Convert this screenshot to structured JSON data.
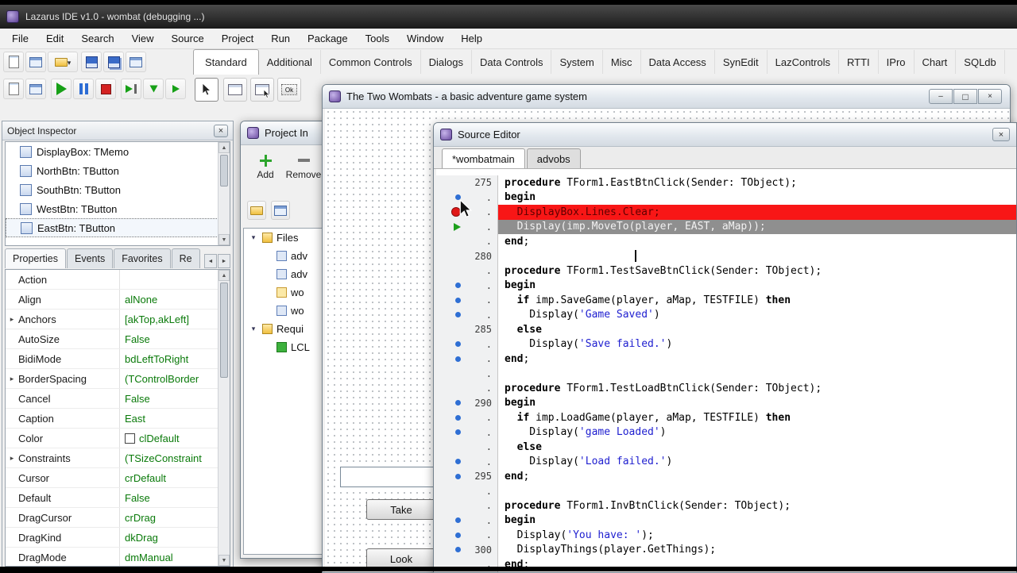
{
  "titlebar": {
    "title": "Lazarus IDE v1.0 - wombat (debugging ...)"
  },
  "menu": {
    "items": [
      "File",
      "Edit",
      "Search",
      "View",
      "Source",
      "Project",
      "Run",
      "Package",
      "Tools",
      "Window",
      "Help"
    ]
  },
  "palette": {
    "tabs": [
      "Standard",
      "Additional",
      "Common Controls",
      "Dialogs",
      "Data Controls",
      "System",
      "Misc",
      "Data Access",
      "SynEdit",
      "LazControls",
      "RTTI",
      "IPro",
      "Chart",
      "SQLdb"
    ],
    "active_tab": "Standard",
    "tbutton_icon_label": "Ok"
  },
  "object_inspector": {
    "title": "Object Inspector",
    "components": [
      "DisplayBox: TMemo",
      "NorthBtn: TButton",
      "SouthBtn: TButton",
      "WestBtn: TButton",
      "EastBtn: TButton"
    ],
    "selected_component": "EastBtn: TButton",
    "tabs": [
      "Properties",
      "Events",
      "Favorites",
      "Re"
    ],
    "active_tab": "Properties",
    "properties": [
      {
        "name": "Action",
        "value": "",
        "expand": false,
        "swatch": false
      },
      {
        "name": "Align",
        "value": "alNone",
        "expand": false,
        "swatch": false
      },
      {
        "name": "Anchors",
        "value": "[akTop,akLeft]",
        "expand": true,
        "swatch": false
      },
      {
        "name": "AutoSize",
        "value": "False",
        "expand": false,
        "swatch": false
      },
      {
        "name": "BidiMode",
        "value": "bdLeftToRight",
        "expand": false,
        "swatch": false
      },
      {
        "name": "BorderSpacing",
        "value": "(TControlBorder",
        "expand": true,
        "swatch": false
      },
      {
        "name": "Cancel",
        "value": "False",
        "expand": false,
        "swatch": false
      },
      {
        "name": "Caption",
        "value": "East",
        "expand": false,
        "swatch": false
      },
      {
        "name": "Color",
        "value": "clDefault",
        "expand": false,
        "swatch": true
      },
      {
        "name": "Constraints",
        "value": "(TSizeConstraint",
        "expand": true,
        "swatch": false
      },
      {
        "name": "Cursor",
        "value": "crDefault",
        "expand": false,
        "swatch": false
      },
      {
        "name": "Default",
        "value": "False",
        "expand": false,
        "swatch": false
      },
      {
        "name": "DragCursor",
        "value": "crDrag",
        "expand": false,
        "swatch": false
      },
      {
        "name": "DragKind",
        "value": "dkDrag",
        "expand": false,
        "swatch": false
      },
      {
        "name": "DragMode",
        "value": "dmManual",
        "expand": false,
        "swatch": false
      }
    ]
  },
  "project_inspector": {
    "title": "Project In",
    "add_label": "Add",
    "remove_label": "Remove",
    "tree": [
      {
        "label": "Files",
        "depth": 0,
        "icon": "folder2",
        "expanded": true
      },
      {
        "label": "adv",
        "depth": 1,
        "icon": "unit",
        "expanded": false
      },
      {
        "label": "adv",
        "depth": 1,
        "icon": "unit",
        "expanded": false
      },
      {
        "label": "wo",
        "depth": 1,
        "icon": "unit-form",
        "expanded": false
      },
      {
        "label": "wo",
        "depth": 1,
        "icon": "unit",
        "expanded": false
      },
      {
        "label": "Requi",
        "depth": 0,
        "icon": "folder2",
        "expanded": true
      },
      {
        "label": "LCL",
        "depth": 1,
        "icon": "package",
        "expanded": false
      }
    ]
  },
  "form_window": {
    "title": "The Two Wombats - a basic adventure game system",
    "buttons": [
      {
        "label": "Take"
      },
      {
        "label": "Look"
      }
    ]
  },
  "source_editor": {
    "title": "Source Editor",
    "tabs": [
      {
        "label": "*wombatmain",
        "active": true
      },
      {
        "label": "advobs",
        "active": false
      }
    ],
    "lines": [
      {
        "n": "275",
        "m": "",
        "bg": "",
        "c": [
          [
            "k",
            "procedure"
          ],
          [
            "t",
            " TForm1.EastBtnClick(Sender: TObject);"
          ]
        ]
      },
      {
        "n": ".",
        "m": "dot",
        "bg": "",
        "c": [
          [
            "k",
            "begin"
          ]
        ]
      },
      {
        "n": ".",
        "m": "bp",
        "bg": "red",
        "c": [
          [
            "t",
            "  DisplayBox.Lines.Clear;"
          ]
        ]
      },
      {
        "n": ".",
        "m": "exec",
        "bg": "gray",
        "c": [
          [
            "t",
            "  Display(imp.MoveTo(player, EAST, aMap));"
          ]
        ]
      },
      {
        "n": ".",
        "m": "",
        "bg": "",
        "c": [
          [
            "k",
            "end"
          ],
          [
            "t",
            ";"
          ]
        ]
      },
      {
        "n": "280",
        "m": "",
        "bg": "",
        "caret": true,
        "c": []
      },
      {
        "n": ".",
        "m": "",
        "bg": "",
        "c": [
          [
            "k",
            "procedure"
          ],
          [
            "t",
            " TForm1.TestSaveBtnClick(Sender: TObject);"
          ]
        ]
      },
      {
        "n": ".",
        "m": "dot",
        "bg": "",
        "c": [
          [
            "k",
            "begin"
          ]
        ]
      },
      {
        "n": ".",
        "m": "dot",
        "bg": "",
        "c": [
          [
            "t",
            "  "
          ],
          [
            "k",
            "if"
          ],
          [
            "t",
            " imp.SaveGame(player, aMap, TESTFILE) "
          ],
          [
            "k",
            "then"
          ]
        ]
      },
      {
        "n": ".",
        "m": "dot",
        "bg": "",
        "c": [
          [
            "t",
            "    Display("
          ],
          [
            "s",
            "'Game Saved'"
          ],
          [
            "t",
            ")"
          ]
        ]
      },
      {
        "n": "285",
        "m": "",
        "bg": "",
        "c": [
          [
            "t",
            "  "
          ],
          [
            "k",
            "else"
          ]
        ]
      },
      {
        "n": ".",
        "m": "dot",
        "bg": "",
        "c": [
          [
            "t",
            "    Display("
          ],
          [
            "s",
            "'Save failed.'"
          ],
          [
            "t",
            ")"
          ]
        ]
      },
      {
        "n": ".",
        "m": "dot",
        "bg": "",
        "c": [
          [
            "k",
            "end"
          ],
          [
            "t",
            ";"
          ]
        ]
      },
      {
        "n": ".",
        "m": "",
        "bg": "",
        "c": []
      },
      {
        "n": ".",
        "m": "",
        "bg": "",
        "c": [
          [
            "k",
            "procedure"
          ],
          [
            "t",
            " TForm1.TestLoadBtnClick(Sender: TObject);"
          ]
        ]
      },
      {
        "n": "290",
        "m": "dot",
        "bg": "",
        "c": [
          [
            "k",
            "begin"
          ]
        ]
      },
      {
        "n": ".",
        "m": "dot",
        "bg": "",
        "c": [
          [
            "t",
            "  "
          ],
          [
            "k",
            "if"
          ],
          [
            "t",
            " imp.LoadGame(player, aMap, TESTFILE) "
          ],
          [
            "k",
            "then"
          ]
        ]
      },
      {
        "n": ".",
        "m": "dot",
        "bg": "",
        "c": [
          [
            "t",
            "    Display("
          ],
          [
            "s",
            "'game Loaded'"
          ],
          [
            "t",
            ")"
          ]
        ]
      },
      {
        "n": ".",
        "m": "",
        "bg": "",
        "c": [
          [
            "t",
            "  "
          ],
          [
            "k",
            "else"
          ]
        ]
      },
      {
        "n": ".",
        "m": "dot",
        "bg": "",
        "c": [
          [
            "t",
            "    Display("
          ],
          [
            "s",
            "'Load failed.'"
          ],
          [
            "t",
            ")"
          ]
        ]
      },
      {
        "n": "295",
        "m": "dot",
        "bg": "",
        "c": [
          [
            "k",
            "end"
          ],
          [
            "t",
            ";"
          ]
        ]
      },
      {
        "n": ".",
        "m": "",
        "bg": "",
        "c": []
      },
      {
        "n": ".",
        "m": "",
        "bg": "",
        "c": [
          [
            "k",
            "procedure"
          ],
          [
            "t",
            " TForm1.InvBtnClick(Sender: TObject);"
          ]
        ]
      },
      {
        "n": ".",
        "m": "dot",
        "bg": "",
        "c": [
          [
            "k",
            "begin"
          ]
        ]
      },
      {
        "n": ".",
        "m": "dot",
        "bg": "",
        "c": [
          [
            "t",
            "  Display("
          ],
          [
            "s",
            "'You have: '"
          ],
          [
            "t",
            ");"
          ]
        ]
      },
      {
        "n": "300",
        "m": "dot",
        "bg": "",
        "c": [
          [
            "t",
            "  DisplayThings(player.GetThings);"
          ]
        ]
      },
      {
        "n": ".",
        "m": "",
        "bg": "",
        "c": [
          [
            "k",
            "end"
          ],
          [
            "t",
            ";"
          ]
        ]
      }
    ]
  }
}
